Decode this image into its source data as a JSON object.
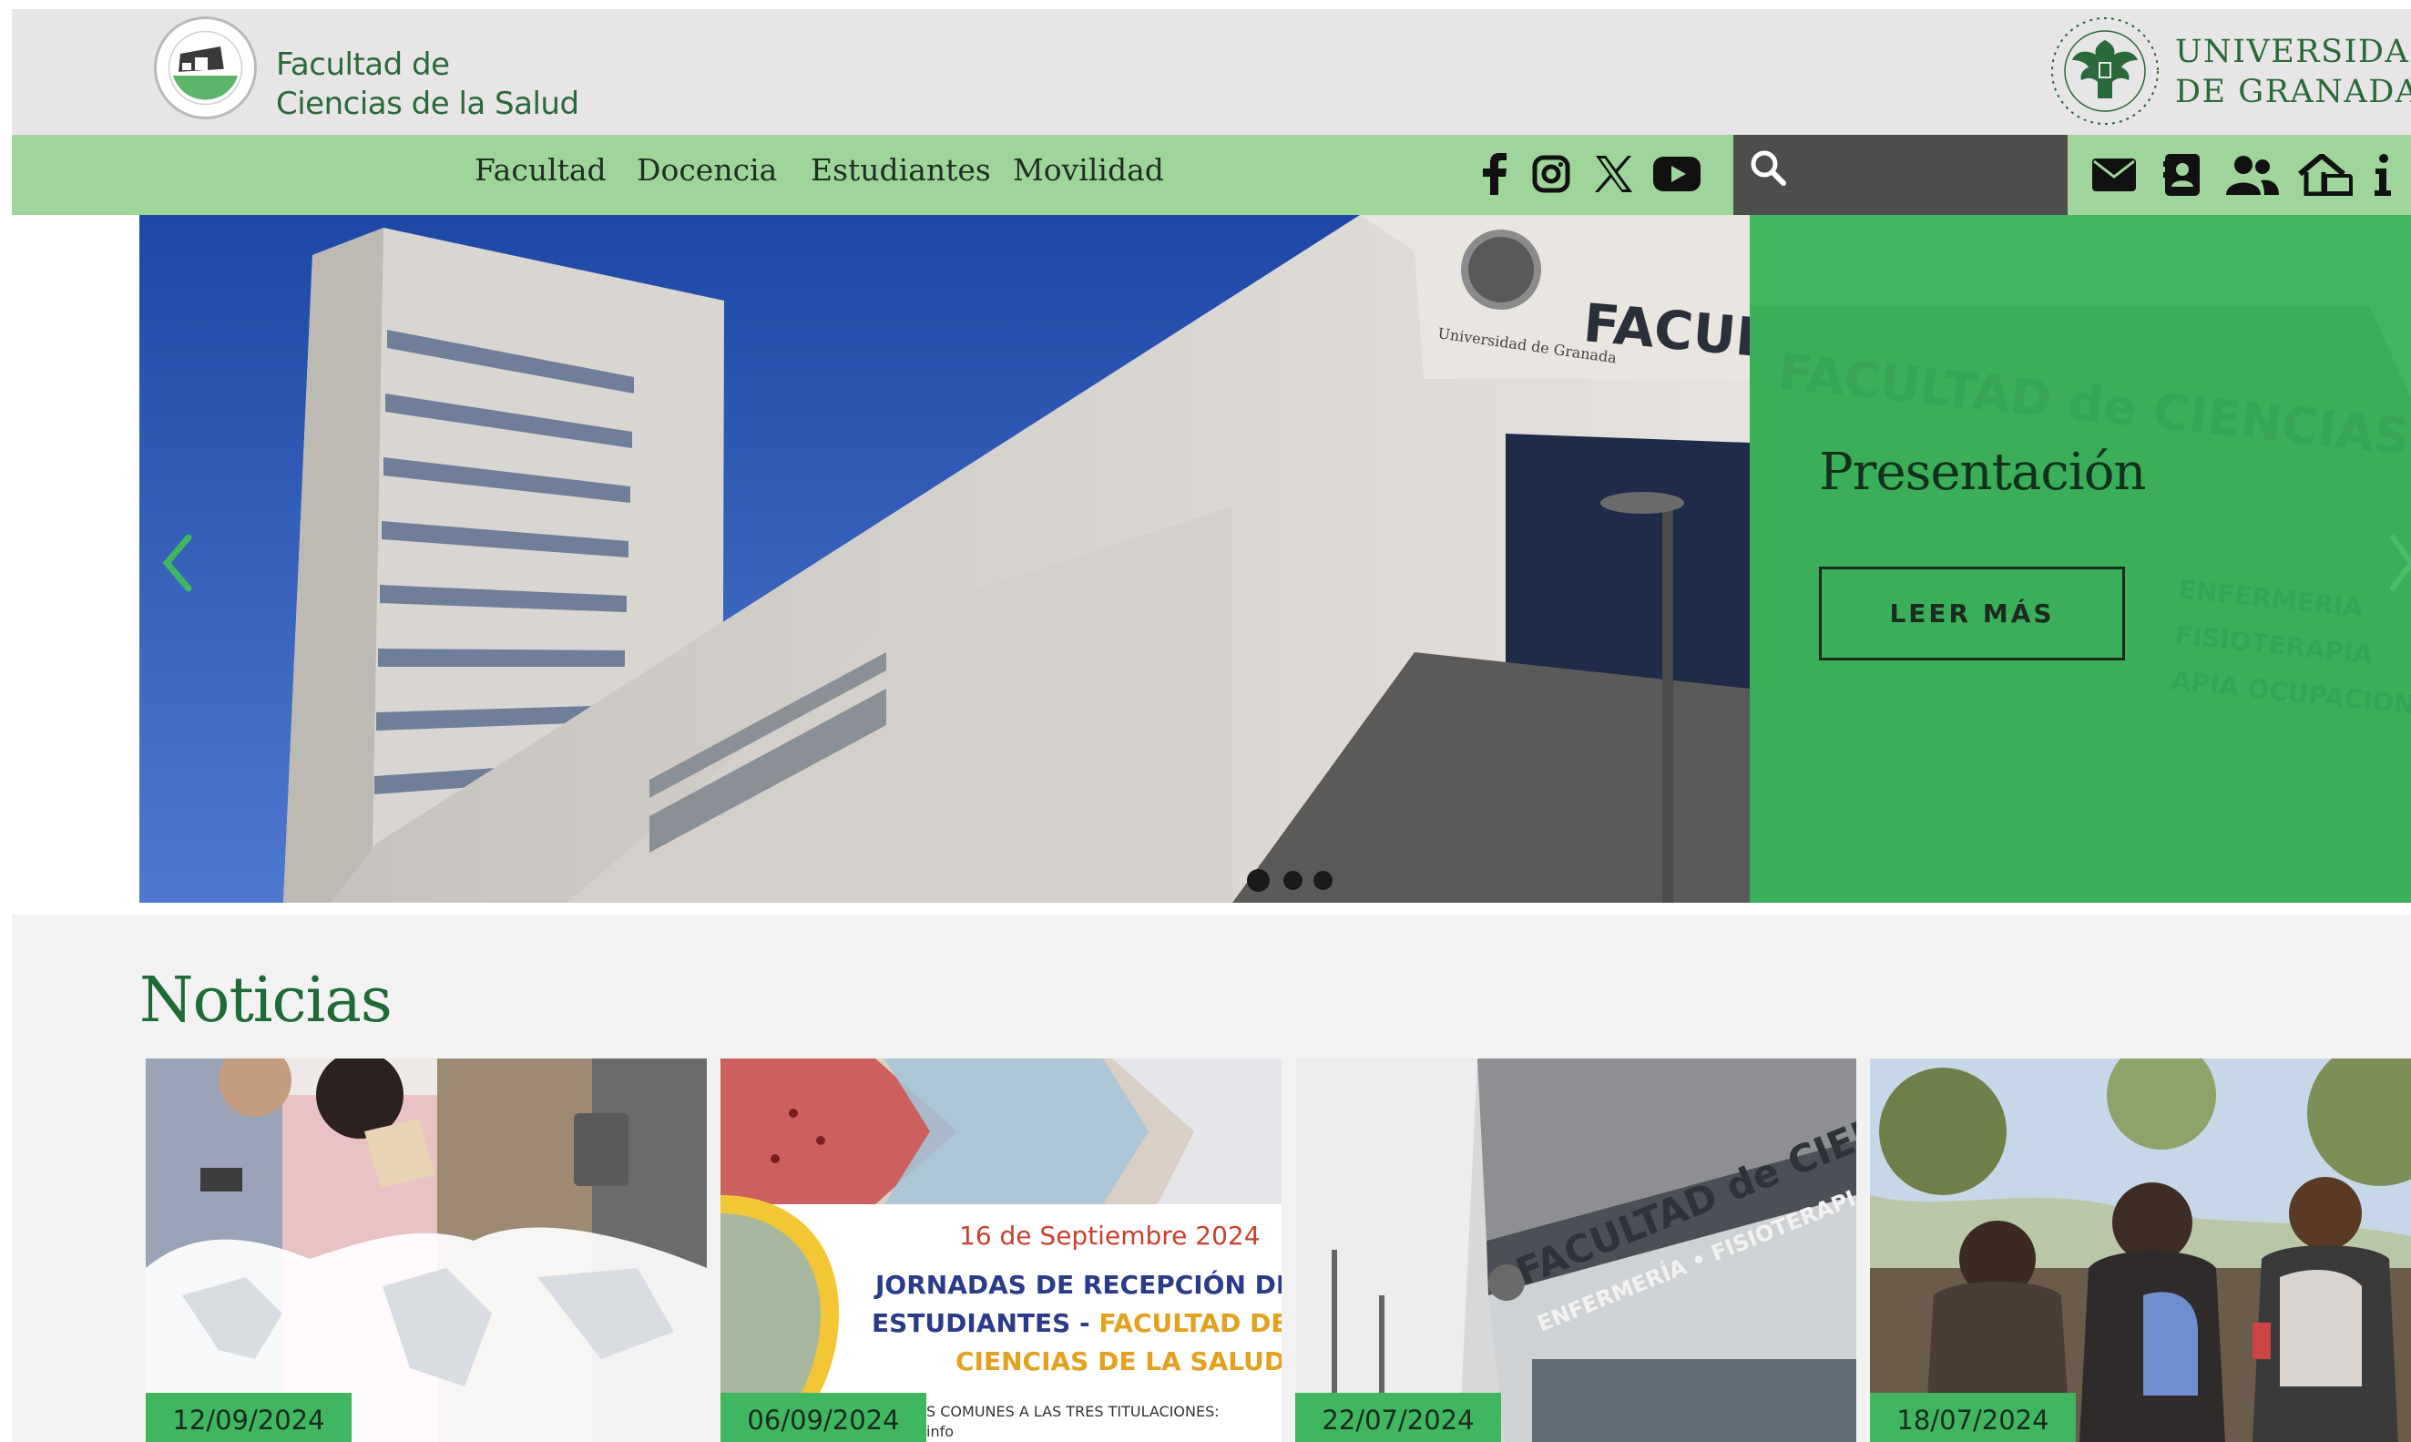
{
  "header": {
    "faculty_line1": "Facultad de",
    "faculty_line2": "Ciencias de la Salud",
    "university_line1": "UNIVERSIDAD",
    "university_line2": "DE GRANADA"
  },
  "nav": {
    "items": [
      {
        "label": "Facultad"
      },
      {
        "label": "Docencia"
      },
      {
        "label": "Estudiantes"
      },
      {
        "label": "Movilidad"
      }
    ],
    "social_icons": [
      "facebook-icon",
      "instagram-icon",
      "x-icon",
      "youtube-icon"
    ],
    "search": {
      "placeholder": "",
      "value": ""
    },
    "quick_icons": [
      "mail-icon",
      "directory-icon",
      "users-icon",
      "home-office-icon",
      "info-icon"
    ]
  },
  "hero": {
    "title": "Presentación",
    "button_label": "LEER MÁS",
    "slides": 3,
    "active_slide": 1,
    "photo_sign": "FACULTAD de CIENCIAS de la SALUD",
    "photo_seal_text": "Universidad de Granada",
    "panel_sign_lines": [
      "ENFERMERIA",
      "FISIOTERAPIA",
      "APIA OCUPACIONAL"
    ]
  },
  "news": {
    "title": "Noticias",
    "cards": [
      {
        "date": "12/09/2024"
      },
      {
        "date": "06/09/2024",
        "poster_date": "16 de Septiembre 2024",
        "poster_title_1": "JORNADAS DE RECEPCIÓN DE",
        "poster_title_2a": "ESTUDIANTES - ",
        "poster_title_2b": "FACULTAD DE",
        "poster_title_3": "CIENCIAS DE LA SALUD",
        "poster_footer": "S COMUNES A LAS TRES TITULACIONES:",
        "poster_footer_2": "info"
      },
      {
        "date": "22/07/2024",
        "building_sign_1": "FACULTAD de CIENCIAS de",
        "building_sign_2": "ENFERMERÍA • FISIOTERAPIA • TERAPIA O"
      },
      {
        "date": "18/07/2024"
      }
    ]
  },
  "colors": {
    "header_bg": "#e7e5e6",
    "nav_bg": "#9fd59a",
    "accent_green": "#3fb65f",
    "brand_green": "#2a6a3a",
    "search_bg": "#4d4d4d"
  }
}
